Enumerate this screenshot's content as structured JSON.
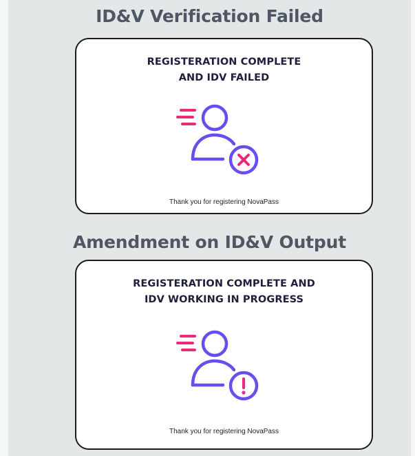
{
  "sections": [
    {
      "title": "ID&V Verification Failed",
      "card": {
        "heading_lines": [
          "REGISTERATION COMPLETE",
          "AND IDV FAILED"
        ],
        "status_icon": "error-x-icon",
        "footer": "Thank you for registering NovaPass"
      }
    },
    {
      "title": "Amendment on ID&V Output",
      "card": {
        "heading_lines": [
          "REGISTERATION COMPLETE AND",
          "IDV WORKING IN PROGRESS"
        ],
        "status_icon": "exclamation-icon",
        "footer": "Thank you for registering NovaPass"
      }
    }
  ],
  "colors": {
    "title": "#4f5764",
    "heading": "#1d1f3d",
    "icon_purple": "#6a4df0",
    "icon_pink": "#f0287a"
  }
}
